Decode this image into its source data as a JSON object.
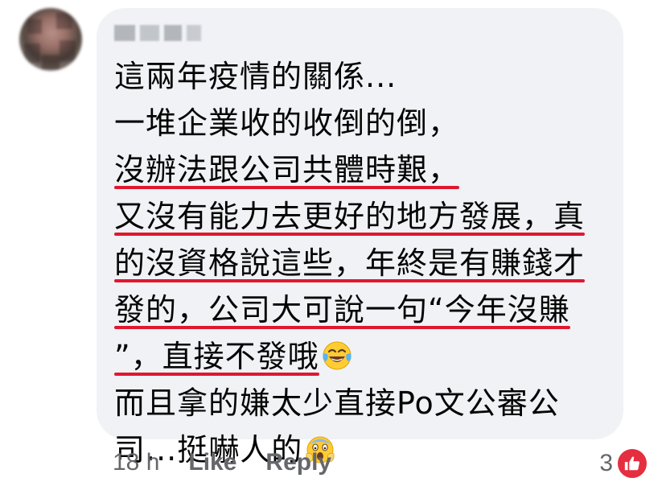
{
  "comment": {
    "author_name": "",
    "lines": [
      {
        "text": "這兩年疫情的關係...",
        "underline": false
      },
      {
        "text": "一堆企業收的收倒的倒，",
        "underline": false
      },
      {
        "text": "沒辦法跟公司共體時艱，",
        "underline": true
      },
      {
        "text": "又沒有能力去更好的地方發展，真",
        "underline": true
      },
      {
        "text": "的沒資格說這些，年終是有賺錢才",
        "underline": true
      },
      {
        "text": "發的，公司大可說一句“今年沒賺",
        "underline": true
      },
      {
        "text": "”，直接不發哦",
        "underline": true,
        "emoji": "tears-of-joy-emoji"
      },
      {
        "text": "而且拿的嫌太少直接Po文公審公",
        "underline": false
      },
      {
        "text": "司...挺嚇人的",
        "underline": false,
        "emoji": "screaming-face-emoji"
      }
    ]
  },
  "footer": {
    "time": "18 h",
    "like_label": "Like",
    "reply_label": "Reply",
    "reaction_count": "3",
    "reaction_icon": "thumbs-up-icon"
  },
  "colors": {
    "bubble": "#f0f2f5",
    "text": "#050505",
    "meta": "#65676b",
    "underline": "#e0182f",
    "reaction_badge": "#e52e3f"
  }
}
